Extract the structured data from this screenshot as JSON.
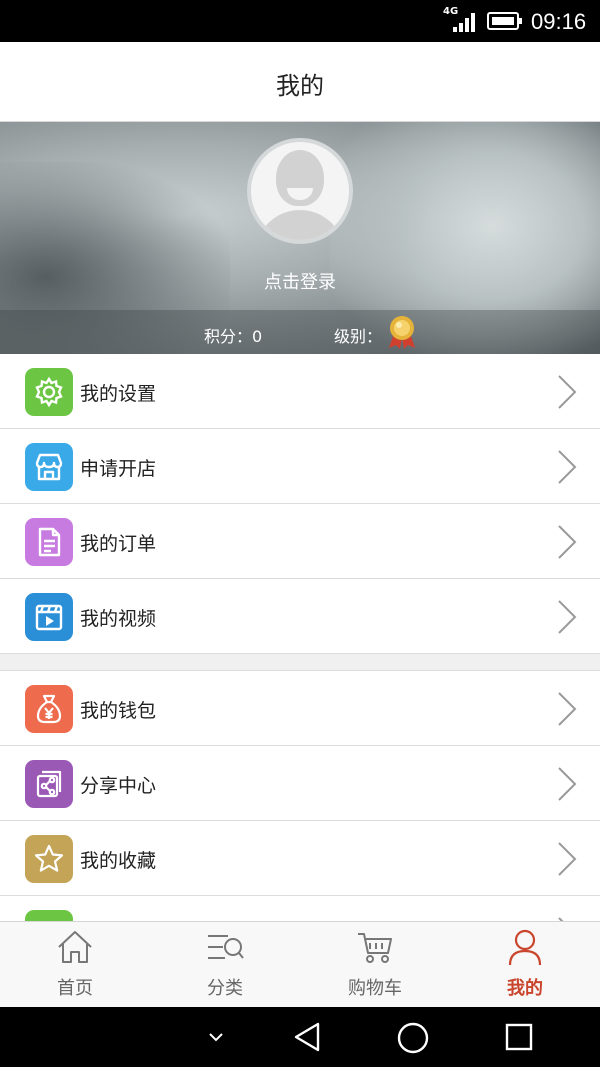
{
  "status_bar": {
    "network": "4G",
    "time": "09:16"
  },
  "header": {
    "title": "我的"
  },
  "profile": {
    "login_text": "点击登录",
    "points_text": "积分：0",
    "level_text": "级别："
  },
  "menu": {
    "group1": [
      {
        "label": "我的设置",
        "icon": "gear-icon",
        "color": "#6cc644"
      },
      {
        "label": "申请开店",
        "icon": "shop-icon",
        "color": "#3aa9e8"
      },
      {
        "label": "我的订单",
        "icon": "document-icon",
        "color": "#c77be0"
      },
      {
        "label": "我的视频",
        "icon": "video-icon",
        "color": "#2b8fd8"
      }
    ],
    "group2": [
      {
        "label": "我的钱包",
        "icon": "money-bag-icon",
        "color": "#ee6b4d"
      },
      {
        "label": "分享中心",
        "icon": "share-icon",
        "color": "#9a59b5"
      },
      {
        "label": "我的收藏",
        "icon": "star-icon",
        "color": "#c4a457"
      }
    ]
  },
  "tabs": [
    {
      "label": "首页",
      "icon": "home-icon",
      "active": false
    },
    {
      "label": "分类",
      "icon": "category-search-icon",
      "active": false
    },
    {
      "label": "购物车",
      "icon": "cart-icon",
      "active": false
    },
    {
      "label": "我的",
      "icon": "user-icon",
      "active": true
    }
  ],
  "colors": {
    "active_tab": "#c9452c",
    "inactive_tab": "#666666"
  }
}
